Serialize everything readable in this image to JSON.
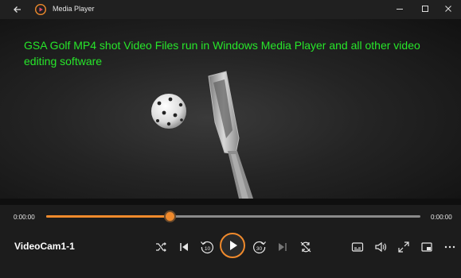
{
  "window": {
    "title": "Media Player"
  },
  "video": {
    "caption": "GSA Golf MP4 shot Video Files run in Windows Media Player and all other video editing software"
  },
  "timeline": {
    "elapsed": "0:00:00",
    "remaining": "0:00:00",
    "progress": 0.33
  },
  "now_playing": {
    "title": "VideoCam1-1"
  },
  "controls": {
    "skip_back_seconds": "10",
    "skip_forward_seconds": "30"
  },
  "colors": {
    "accent": "#f08a2c",
    "caption": "#27e62a"
  }
}
